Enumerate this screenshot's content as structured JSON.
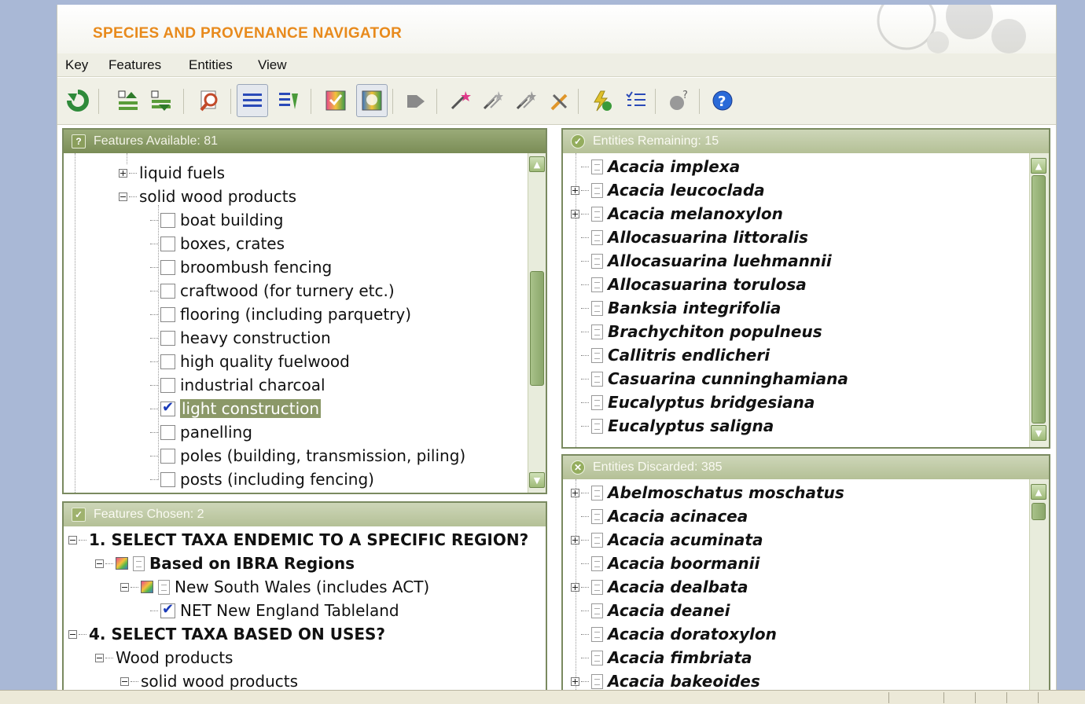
{
  "app": {
    "title": "SPECIES AND PROVENANCE NAVIGATOR"
  },
  "menu": [
    "Key",
    "Features",
    "Entities",
    "View"
  ],
  "toolbar": [
    {
      "icon": "refresh-icon"
    },
    {
      "icon": "upload-features-icon"
    },
    {
      "icon": "download-features-icon"
    },
    {
      "icon": "find-icon"
    },
    {
      "icon": "list-view-icon",
      "active": true
    },
    {
      "icon": "list-sort-icon"
    },
    {
      "icon": "image-check-icon"
    },
    {
      "icon": "image-select-icon",
      "active": true
    },
    {
      "icon": "tag-icon"
    },
    {
      "icon": "magic-wand-icon"
    },
    {
      "icon": "magic-wand-2-icon"
    },
    {
      "icon": "magic-wand-3-icon"
    },
    {
      "icon": "tools-icon"
    },
    {
      "icon": "lightning-icon"
    },
    {
      "icon": "checklist-icon"
    },
    {
      "icon": "help-query-icon"
    },
    {
      "icon": "help-icon"
    }
  ],
  "features_available": {
    "header": "Features Available: 81",
    "items": [
      {
        "label": "liquid fuels",
        "type": "folder",
        "expanded": false
      },
      {
        "label": "solid wood products",
        "type": "folder",
        "expanded": true
      },
      {
        "label": "boat building",
        "checked": false
      },
      {
        "label": "boxes, crates",
        "checked": false
      },
      {
        "label": "broombush fencing",
        "checked": false
      },
      {
        "label": "craftwood (for turnery etc.)",
        "checked": false
      },
      {
        "label": "flooring (including parquetry)",
        "checked": false
      },
      {
        "label": "heavy construction",
        "checked": false
      },
      {
        "label": "high quality fuelwood",
        "checked": false
      },
      {
        "label": "industrial charcoal",
        "checked": false
      },
      {
        "label": "light construction",
        "checked": true,
        "selected": true
      },
      {
        "label": "panelling",
        "checked": false
      },
      {
        "label": "poles (building, transmission, piling)",
        "checked": false
      },
      {
        "label": "posts (including fencing)",
        "checked": false
      }
    ]
  },
  "features_chosen": {
    "header": "Features Chosen: 2",
    "items": [
      {
        "label": "1. SELECT TAXA ENDEMIC TO A SPECIFIC REGION?",
        "level": 0
      },
      {
        "label": "Based on IBRA Regions",
        "level": 1
      },
      {
        "label": "New South Wales (includes ACT)",
        "level": 2
      },
      {
        "label": "NET New England Tableland",
        "level": 3
      },
      {
        "label": "4. SELECT TAXA BASED ON USES?",
        "level": 0
      },
      {
        "label": "Wood products",
        "level": 1
      },
      {
        "label": "solid wood products",
        "level": 2
      }
    ]
  },
  "entities_remaining": {
    "header": "Entities Remaining: 15",
    "items": [
      {
        "name": "Acacia implexa",
        "expandable": false
      },
      {
        "name": "Acacia leucoclada",
        "expandable": true
      },
      {
        "name": "Acacia melanoxylon",
        "expandable": true
      },
      {
        "name": "Allocasuarina littoralis",
        "expandable": false
      },
      {
        "name": "Allocasuarina luehmannii",
        "expandable": false
      },
      {
        "name": "Allocasuarina torulosa",
        "expandable": false
      },
      {
        "name": "Banksia integrifolia",
        "expandable": false
      },
      {
        "name": "Brachychiton populneus",
        "expandable": false
      },
      {
        "name": "Callitris endlicheri",
        "expandable": false
      },
      {
        "name": "Casuarina cunninghamiana",
        "expandable": false
      },
      {
        "name": "Eucalyptus bridgesiana",
        "expandable": false
      },
      {
        "name": "Eucalyptus saligna",
        "expandable": false
      }
    ]
  },
  "entities_discarded": {
    "header": "Entities Discarded: 385",
    "items": [
      {
        "name": "Abelmoschatus moschatus",
        "expandable": true
      },
      {
        "name": "Acacia acinacea",
        "expandable": false
      },
      {
        "name": "Acacia acuminata",
        "expandable": true
      },
      {
        "name": "Acacia boormanii",
        "expandable": false
      },
      {
        "name": "Acacia dealbata",
        "expandable": true
      },
      {
        "name": "Acacia deanei",
        "expandable": false
      },
      {
        "name": "Acacia doratoxylon",
        "expandable": false
      },
      {
        "name": "Acacia fimbriata",
        "expandable": false
      },
      {
        "name": "Acacia bakeoides",
        "expandable": true
      }
    ]
  }
}
